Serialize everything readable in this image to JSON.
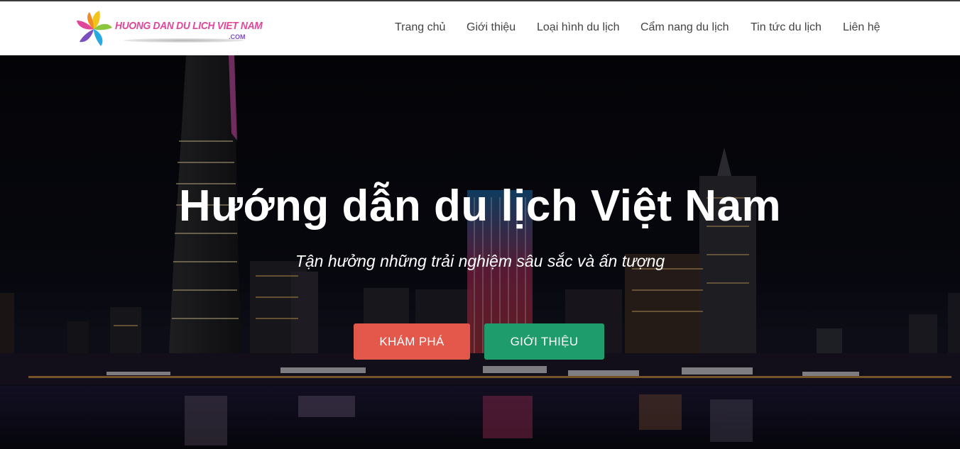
{
  "brand": {
    "logo_text": "HUONG DAN DU LICH VIET NAM",
    "logo_suffix": ".COM"
  },
  "nav": {
    "items": [
      {
        "label": "Trang chủ"
      },
      {
        "label": "Giới thiệu"
      },
      {
        "label": "Loại hình du lịch"
      },
      {
        "label": "Cẩm nang du lịch"
      },
      {
        "label": "Tin tức du lịch"
      },
      {
        "label": "Liên hệ"
      }
    ]
  },
  "hero": {
    "title": "Hướng dẫn du lịch Việt Nam",
    "subtitle": "Tận hưởng những trải nghiệm sâu sắc và ấn tượng",
    "buttons": {
      "explore_label": "KHÁM PHÁ",
      "about_label": "GIỚI THIỆU"
    }
  },
  "colors": {
    "explore_button": "#e4574b",
    "about_button": "#1f9c6b",
    "nav_text": "#444444",
    "logo_pink": "#e0479b"
  }
}
